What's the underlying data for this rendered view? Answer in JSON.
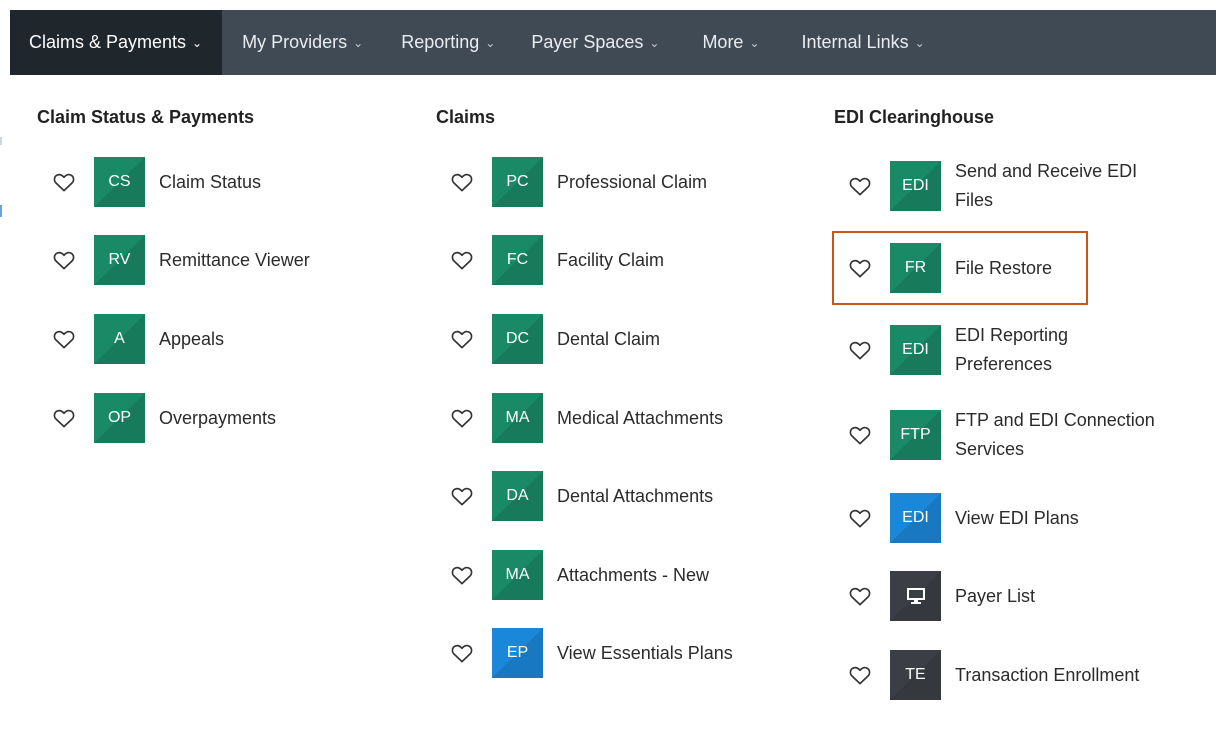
{
  "nav": {
    "items": [
      {
        "label": "Claims & Payments"
      },
      {
        "label": "My Providers"
      },
      {
        "label": "Reporting"
      },
      {
        "label": "Payer Spaces"
      },
      {
        "label": "More"
      },
      {
        "label": "Internal Links"
      }
    ],
    "active_index": 0
  },
  "columns": [
    {
      "title": "Claim Status & Payments",
      "items": [
        {
          "badge": "CS",
          "label": "Claim Status",
          "color": "#1a8a66"
        },
        {
          "badge": "RV",
          "label": "Remittance Viewer",
          "color": "#1a8a66"
        },
        {
          "badge": "A",
          "label": "Appeals",
          "color": "#1a8a66"
        },
        {
          "badge": "OP",
          "label": "Overpayments",
          "color": "#1a8a66"
        }
      ]
    },
    {
      "title": "Claims",
      "items": [
        {
          "badge": "PC",
          "label": "Professional Claim",
          "color": "#1a8a66"
        },
        {
          "badge": "FC",
          "label": "Facility Claim",
          "color": "#1a8a66"
        },
        {
          "badge": "DC",
          "label": "Dental Claim",
          "color": "#1a8a66"
        },
        {
          "badge": "MA",
          "label": "Medical Attachments",
          "color": "#1a8a66"
        },
        {
          "badge": "DA",
          "label": "Dental Attachments",
          "color": "#1a8a66"
        },
        {
          "badge": "MA",
          "label": "Attachments - New",
          "color": "#1a8a66"
        },
        {
          "badge": "EP",
          "label": "View Essentials Plans",
          "color": "#1b87d8"
        }
      ]
    },
    {
      "title": "EDI Clearinghouse",
      "items": [
        {
          "badge": "EDI",
          "label_line1": "Send and Receive EDI",
          "label_line2": "Files",
          "color": "#1a8a66"
        },
        {
          "badge": "FR",
          "label": "File Restore",
          "color": "#1a8a66",
          "highlighted": true
        },
        {
          "badge": "EDI",
          "label_line1": "EDI Reporting",
          "label_line2": "Preferences",
          "color": "#1a8a66"
        },
        {
          "badge": "FTP",
          "label_line1": "FTP and EDI Connection",
          "label_line2": "Services",
          "color": "#1a8a66"
        },
        {
          "badge": "EDI",
          "label": "View EDI Plans",
          "color": "#1b87d8"
        },
        {
          "icon": "monitor-icon",
          "label": "Payer List",
          "color": "#3b3f45"
        },
        {
          "badge": "TE",
          "label": "Transaction Enrollment",
          "color": "#3b3f45"
        }
      ]
    }
  ],
  "colors": {
    "nav_bg": "#3f4a55",
    "nav_active_bg": "#1f262c",
    "highlight_border": "#c9541a"
  }
}
